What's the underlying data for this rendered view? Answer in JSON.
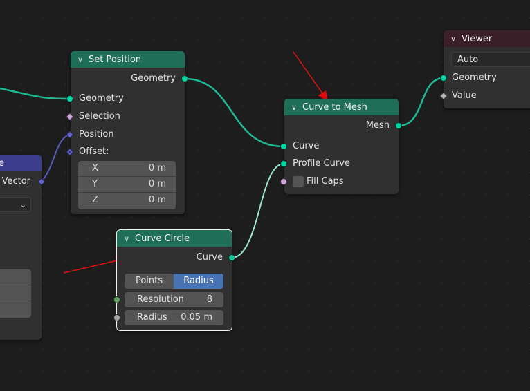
{
  "set_position": {
    "title": "Set Position",
    "output_geometry": "Geometry",
    "inputs": {
      "geometry": "Geometry",
      "selection": "Selection",
      "position": "Position",
      "offset": "Offset:"
    },
    "offset": [
      {
        "axis": "X",
        "value": "0 m"
      },
      {
        "axis": "Y",
        "value": "0 m"
      },
      {
        "axis": "Z",
        "value": "0 m"
      }
    ]
  },
  "curve_to_mesh": {
    "title": "Curve to Mesh",
    "output_mesh": "Mesh",
    "inputs": {
      "curve": "Curve",
      "profile_curve": "Profile Curve",
      "fill_caps": "Fill Caps"
    },
    "fill_caps_checked": false
  },
  "viewer": {
    "title": "Viewer",
    "domain_value": "Auto",
    "inputs": {
      "geometry": "Geometry",
      "value": "Value"
    }
  },
  "curve_circle": {
    "title": "Curve Circle",
    "output_curve": "Curve",
    "mode_options": [
      "Points",
      "Radius"
    ],
    "mode_selected": "Radius",
    "resolution_label": "Resolution",
    "resolution_value": "8",
    "radius_label": "Radius",
    "radius_value": "0.05 m"
  },
  "left_node": {
    "title_fragment": "e",
    "output_vector": "Vector"
  },
  "colors": {
    "geometry_socket": "#00d6a3",
    "vector_socket": "#6363c7",
    "annotation_arrow": "#e01010",
    "radius_selected": "#4772b3"
  }
}
